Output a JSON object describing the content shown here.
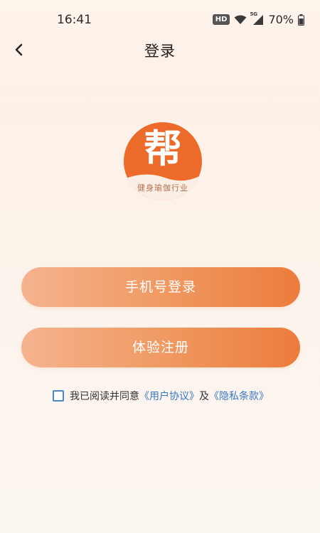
{
  "status_bar": {
    "time": "16:41",
    "hd_label": "HD",
    "network_label": "5G",
    "battery": "70%",
    "icons": [
      "wifi-icon",
      "cellular-signal-icon",
      "battery-icon"
    ]
  },
  "nav": {
    "title": "登录",
    "back_icon": "chevron-left-icon"
  },
  "logo": {
    "character": "帮",
    "subtitle": "健身瑜伽行业",
    "brand_color": "#ec6b2a"
  },
  "buttons": {
    "phone_login": "手机号登录",
    "register": "体验注册"
  },
  "agreement": {
    "checked": false,
    "prefix": "我已阅读并同意",
    "user_agreement": "《用户协议》",
    "conjunction": "及",
    "privacy_policy": "《隐私条款》",
    "link_color": "#3a78c2"
  },
  "colors": {
    "button_gradient_start": "#f5b38e",
    "button_gradient_end": "#ec7c3c",
    "background": "#fdf4ec"
  }
}
